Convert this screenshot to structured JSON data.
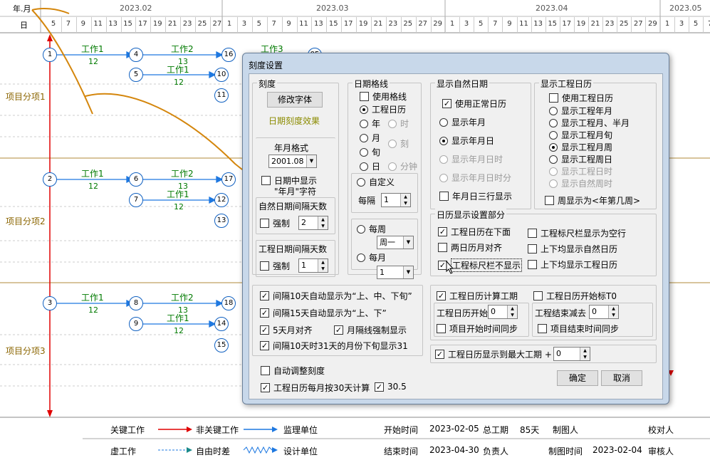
{
  "timeline": {
    "header_left_top": "年.月",
    "header_left_bottom": "日",
    "months": [
      "2023.02",
      "2023.03",
      "2023.04",
      "2023.05"
    ],
    "days_feb": [
      "5",
      "7",
      "9",
      "11",
      "13",
      "15",
      "17",
      "19",
      "21",
      "23",
      "25",
      "27"
    ],
    "days_mar": [
      "1",
      "3",
      "5",
      "7",
      "9",
      "11",
      "13",
      "15",
      "17",
      "19",
      "21",
      "23",
      "25",
      "27",
      "29"
    ],
    "days_apr": [
      "1",
      "3",
      "5",
      "7",
      "9",
      "11",
      "13",
      "15",
      "17",
      "19",
      "21",
      "23",
      "25",
      "27",
      "29"
    ],
    "days_may": [
      "1",
      "3",
      "5",
      "7"
    ]
  },
  "rows": [
    {
      "label": "项目分项1",
      "nodes": [
        "1",
        "4",
        "16",
        "5",
        "10",
        "11"
      ],
      "tasks": [
        "工作1",
        "工作2",
        "工作1",
        "工作3"
      ],
      "durs": [
        "12",
        "13",
        "12"
      ],
      "partial": "05"
    },
    {
      "label": "项目分项2",
      "nodes": [
        "2",
        "6",
        "17",
        "7",
        "12",
        "13"
      ],
      "tasks": [
        "工作1",
        "工作2",
        "工作1"
      ],
      "durs": [
        "12",
        "13",
        "12"
      ]
    },
    {
      "label": "项目分项3",
      "nodes": [
        "3",
        "8",
        "18",
        "9",
        "14",
        "15"
      ],
      "tasks": [
        "工作1",
        "工作2",
        "工作1"
      ],
      "durs": [
        "12",
        "13",
        "12"
      ]
    }
  ],
  "footer": {
    "key_work": "关键工作",
    "nonkey_work": "非关键工作",
    "supervisor": "监理单位",
    "start_label": "开始时间",
    "start_value": "2023-02-05",
    "total_label": "总工期",
    "total_value": "85天",
    "drawer": "制图人",
    "checker": "校对人",
    "virtual_work": "虚工作",
    "free_float": "自由时差",
    "design": "设计单位",
    "end_label": "结束时间",
    "end_value": "2023-04-30",
    "owner": "负责人",
    "draw_time_label": "制图时间",
    "draw_time_value": "2023-02-04",
    "reviewer": "审核人"
  },
  "dialog": {
    "title": "刻度设置",
    "scale": {
      "title": "刻度",
      "font_button": "修改字体",
      "effect_text": "日期刻度效果",
      "ym_format_title": "年月格式",
      "ym_format_value": "2001.08",
      "show_ym_label_1": "日期中显示",
      "show_ym_label_2": "\"年月\"字符",
      "natural_interval_title": "自然日期间隔天数",
      "natural_force": "强制",
      "natural_value": "2",
      "work_interval_title": "工程日期间隔天数",
      "work_force": "强制",
      "work_value": "1"
    },
    "gridline": {
      "title": "日期格线",
      "use_grid": "使用格线",
      "work_cal": "工程日历",
      "year": "年",
      "hour": "时",
      "month": "月",
      "quarter": "刻",
      "xun": "旬",
      "day": "日",
      "minute": "分钟",
      "custom": "自定义",
      "every_label": "每隔",
      "every_value": "1",
      "weekly": "每周",
      "weekday_value": "周一",
      "monthly": "每月",
      "monthday_value": "1"
    },
    "natural": {
      "title": "显示自然日期",
      "use_normal": "使用正常日历",
      "show_ym": "显示年月",
      "show_ymd": "显示年月日",
      "show_ymdh": "显示年月日时",
      "show_ymdhm": "显示年月日时分",
      "three_rows": "年月日三行显示"
    },
    "workcal": {
      "title": "显示工程日历",
      "use_work": "使用工程日历",
      "show_ym": "显示工程年月",
      "show_half": "显示工程月、半月",
      "show_xun": "显示工程月旬",
      "show_week": "显示工程月周",
      "show_weekday": "显示工程周日",
      "show_day_hour": "显示工程日时",
      "show_natural_week": "显示自然周时",
      "week_as": "周显示为<年第几周>"
    },
    "calendar_part": {
      "title": "日历显示设置部分",
      "below": "工程日历在下面",
      "ruler_empty": "工程标尺栏显示为空行",
      "two_align": "两日历月对齐",
      "natural_both": "上下均显示自然日历",
      "ruler_hide": "工程标尺栏不显示",
      "work_both": "上下均显示工程日历"
    },
    "auto": {
      "opt1": "间隔10天自动显示为“上、中、下旬”",
      "opt2": "间隔15天自动显示为“上、下”",
      "opt3": "5天月对齐",
      "opt4": "月隔线强制显示",
      "opt5": "间隔10天时31天的月份下旬显示31"
    },
    "calc": {
      "calc_period": "工程日历计算工期",
      "start_t0": "工程日历开始标T0",
      "cal_start_label": "工程日历开始",
      "cal_start_value": "0",
      "end_reduce_label": "工程结束减去",
      "end_reduce_value": "0",
      "sync_start": "项目开始时间同步",
      "sync_end": "项目结束时间同步",
      "show_max": "工程日历显示到最大工期 +",
      "show_max_value": "0"
    },
    "auto_adjust": "自动调整刻度",
    "month30": "工程日历每月按30天计算",
    "month30_value": "30.5",
    "ok": "确定",
    "cancel": "取消"
  },
  "colors": {
    "critical": "#e00000",
    "noncritical": "#1e78e0",
    "brand_line": "#d4860c"
  }
}
